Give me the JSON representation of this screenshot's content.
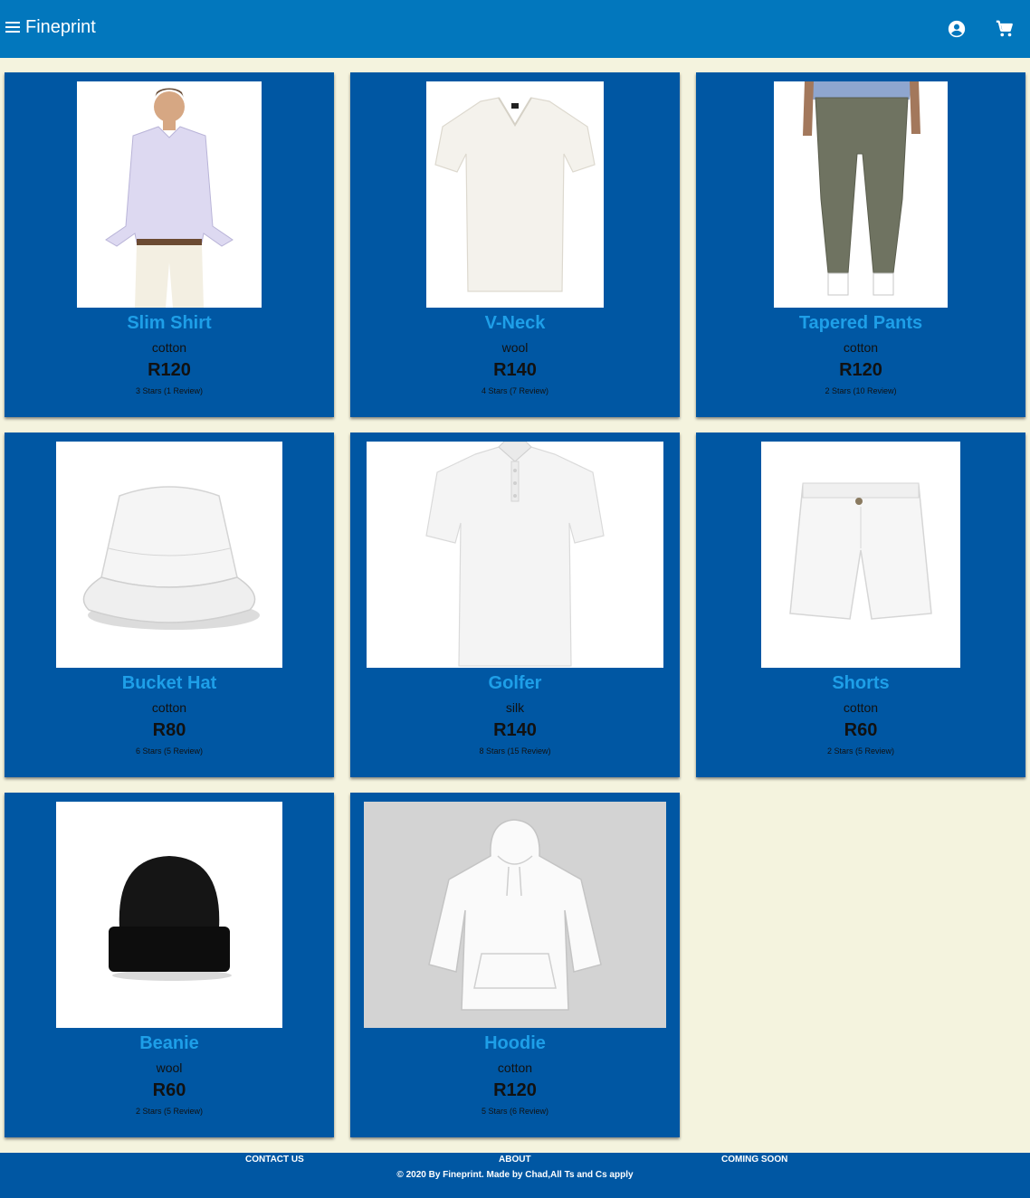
{
  "header": {
    "brand": "Fineprint",
    "icons": [
      "menu-icon",
      "account-circle-icon",
      "shopping-cart-icon"
    ]
  },
  "products": [
    {
      "name": "Slim Shirt",
      "material": "cotton",
      "price": "R120",
      "reviews": "3 Stars (1 Review)"
    },
    {
      "name": "V-Neck",
      "material": "wool",
      "price": "R140",
      "reviews": "4 Stars (7 Review)"
    },
    {
      "name": "Tapered Pants",
      "material": "cotton",
      "price": "R120",
      "reviews": "2 Stars (10 Review)"
    },
    {
      "name": "Bucket Hat",
      "material": "cotton",
      "price": "R80",
      "reviews": "6 Stars (5 Review)"
    },
    {
      "name": "Golfer",
      "material": "silk",
      "price": "R140",
      "reviews": "8 Stars (15 Review)"
    },
    {
      "name": "Shorts",
      "material": "cotton",
      "price": "R60",
      "reviews": "2 Stars (5 Review)"
    },
    {
      "name": "Beanie",
      "material": "wool",
      "price": "R60",
      "reviews": "2 Stars (5 Review)"
    },
    {
      "name": "Hoodie",
      "material": "cotton",
      "price": "R120",
      "reviews": "5 Stars (6 Review)"
    }
  ],
  "footer": {
    "contact": "CONTACT US",
    "about": "ABOUT",
    "coming_soon": "COMING SOON",
    "copyright": "© 2020 By Fineprint. Made by Chad,All Ts and Cs apply"
  },
  "colors": {
    "header": "#0277bd",
    "card": "#0057a3",
    "product_name": "#1e9fe8",
    "page_background": "#f4f3de"
  }
}
